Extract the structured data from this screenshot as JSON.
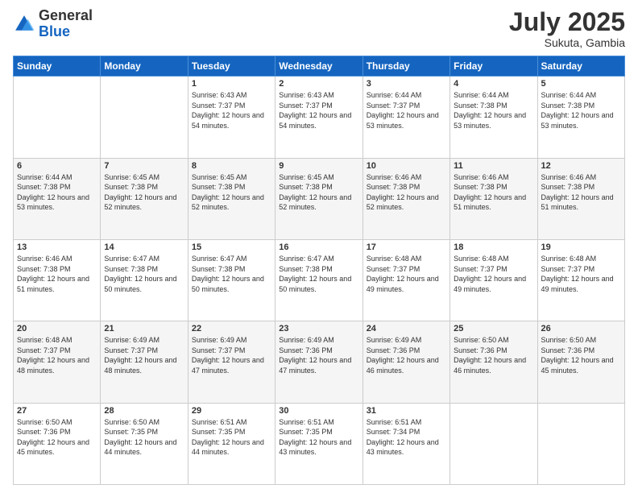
{
  "header": {
    "logo": {
      "general": "General",
      "blue": "Blue"
    },
    "title": "July 2025",
    "location": "Sukuta, Gambia"
  },
  "days_of_week": [
    "Sunday",
    "Monday",
    "Tuesday",
    "Wednesday",
    "Thursday",
    "Friday",
    "Saturday"
  ],
  "weeks": [
    [
      {
        "day": "",
        "info": ""
      },
      {
        "day": "",
        "info": ""
      },
      {
        "day": "1",
        "sunrise": "6:43 AM",
        "sunset": "7:37 PM",
        "daylight": "12 hours and 54 minutes."
      },
      {
        "day": "2",
        "sunrise": "6:43 AM",
        "sunset": "7:37 PM",
        "daylight": "12 hours and 54 minutes."
      },
      {
        "day": "3",
        "sunrise": "6:44 AM",
        "sunset": "7:37 PM",
        "daylight": "12 hours and 53 minutes."
      },
      {
        "day": "4",
        "sunrise": "6:44 AM",
        "sunset": "7:38 PM",
        "daylight": "12 hours and 53 minutes."
      },
      {
        "day": "5",
        "sunrise": "6:44 AM",
        "sunset": "7:38 PM",
        "daylight": "12 hours and 53 minutes."
      }
    ],
    [
      {
        "day": "6",
        "sunrise": "6:44 AM",
        "sunset": "7:38 PM",
        "daylight": "12 hours and 53 minutes."
      },
      {
        "day": "7",
        "sunrise": "6:45 AM",
        "sunset": "7:38 PM",
        "daylight": "12 hours and 52 minutes."
      },
      {
        "day": "8",
        "sunrise": "6:45 AM",
        "sunset": "7:38 PM",
        "daylight": "12 hours and 52 minutes."
      },
      {
        "day": "9",
        "sunrise": "6:45 AM",
        "sunset": "7:38 PM",
        "daylight": "12 hours and 52 minutes."
      },
      {
        "day": "10",
        "sunrise": "6:46 AM",
        "sunset": "7:38 PM",
        "daylight": "12 hours and 52 minutes."
      },
      {
        "day": "11",
        "sunrise": "6:46 AM",
        "sunset": "7:38 PM",
        "daylight": "12 hours and 51 minutes."
      },
      {
        "day": "12",
        "sunrise": "6:46 AM",
        "sunset": "7:38 PM",
        "daylight": "12 hours and 51 minutes."
      }
    ],
    [
      {
        "day": "13",
        "sunrise": "6:46 AM",
        "sunset": "7:38 PM",
        "daylight": "12 hours and 51 minutes."
      },
      {
        "day": "14",
        "sunrise": "6:47 AM",
        "sunset": "7:38 PM",
        "daylight": "12 hours and 50 minutes."
      },
      {
        "day": "15",
        "sunrise": "6:47 AM",
        "sunset": "7:38 PM",
        "daylight": "12 hours and 50 minutes."
      },
      {
        "day": "16",
        "sunrise": "6:47 AM",
        "sunset": "7:38 PM",
        "daylight": "12 hours and 50 minutes."
      },
      {
        "day": "17",
        "sunrise": "6:48 AM",
        "sunset": "7:37 PM",
        "daylight": "12 hours and 49 minutes."
      },
      {
        "day": "18",
        "sunrise": "6:48 AM",
        "sunset": "7:37 PM",
        "daylight": "12 hours and 49 minutes."
      },
      {
        "day": "19",
        "sunrise": "6:48 AM",
        "sunset": "7:37 PM",
        "daylight": "12 hours and 49 minutes."
      }
    ],
    [
      {
        "day": "20",
        "sunrise": "6:48 AM",
        "sunset": "7:37 PM",
        "daylight": "12 hours and 48 minutes."
      },
      {
        "day": "21",
        "sunrise": "6:49 AM",
        "sunset": "7:37 PM",
        "daylight": "12 hours and 48 minutes."
      },
      {
        "day": "22",
        "sunrise": "6:49 AM",
        "sunset": "7:37 PM",
        "daylight": "12 hours and 47 minutes."
      },
      {
        "day": "23",
        "sunrise": "6:49 AM",
        "sunset": "7:36 PM",
        "daylight": "12 hours and 47 minutes."
      },
      {
        "day": "24",
        "sunrise": "6:49 AM",
        "sunset": "7:36 PM",
        "daylight": "12 hours and 46 minutes."
      },
      {
        "day": "25",
        "sunrise": "6:50 AM",
        "sunset": "7:36 PM",
        "daylight": "12 hours and 46 minutes."
      },
      {
        "day": "26",
        "sunrise": "6:50 AM",
        "sunset": "7:36 PM",
        "daylight": "12 hours and 45 minutes."
      }
    ],
    [
      {
        "day": "27",
        "sunrise": "6:50 AM",
        "sunset": "7:36 PM",
        "daylight": "12 hours and 45 minutes."
      },
      {
        "day": "28",
        "sunrise": "6:50 AM",
        "sunset": "7:35 PM",
        "daylight": "12 hours and 44 minutes."
      },
      {
        "day": "29",
        "sunrise": "6:51 AM",
        "sunset": "7:35 PM",
        "daylight": "12 hours and 44 minutes."
      },
      {
        "day": "30",
        "sunrise": "6:51 AM",
        "sunset": "7:35 PM",
        "daylight": "12 hours and 43 minutes."
      },
      {
        "day": "31",
        "sunrise": "6:51 AM",
        "sunset": "7:34 PM",
        "daylight": "12 hours and 43 minutes."
      },
      {
        "day": "",
        "info": ""
      },
      {
        "day": "",
        "info": ""
      }
    ]
  ]
}
